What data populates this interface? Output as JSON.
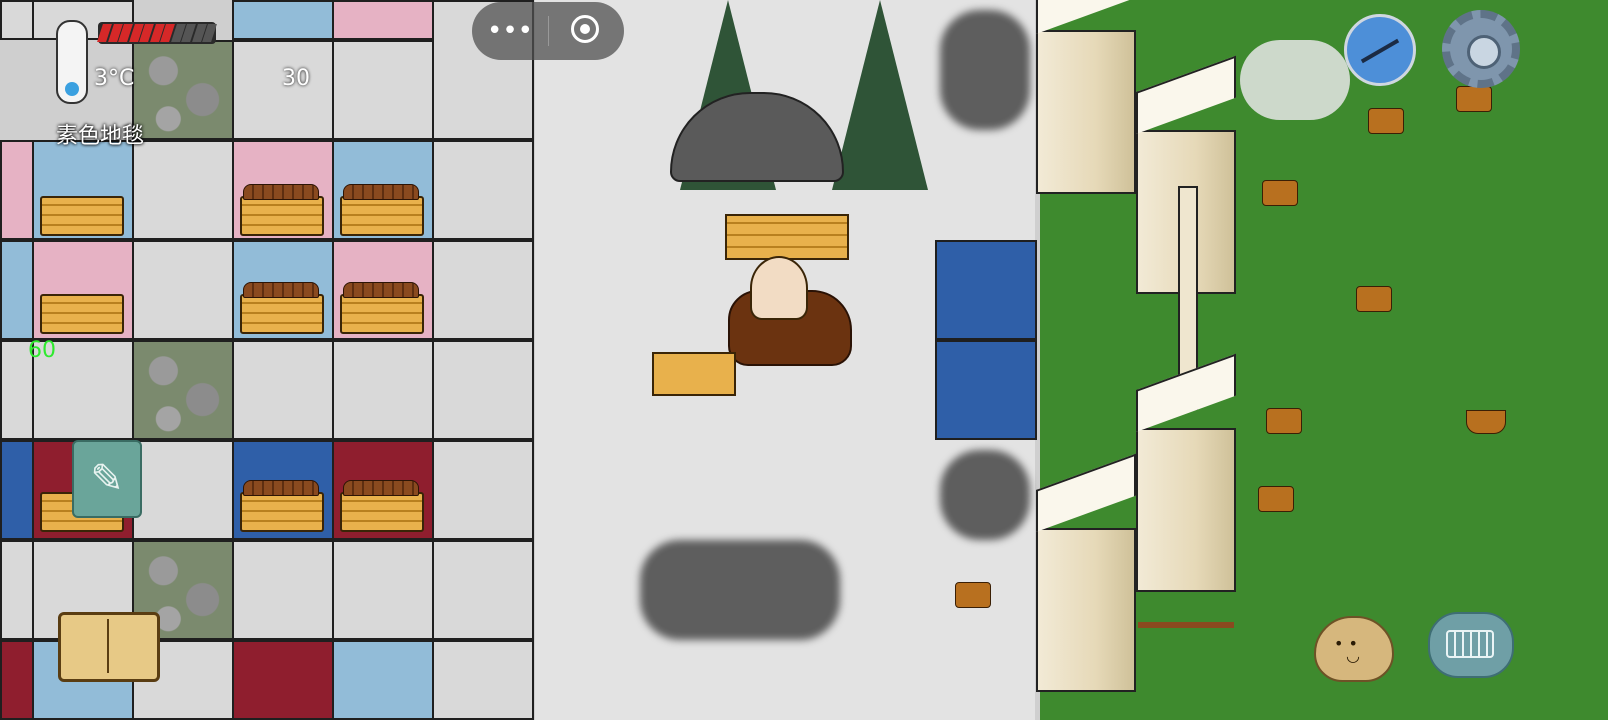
{
  "hud": {
    "temperature": "3°C",
    "food_pips_total": 11,
    "food_pips_filled": 7,
    "food_value": "30",
    "held_item": "素色地毯",
    "age": "60"
  },
  "mini_program_capsule": {
    "more_glyph": "•••",
    "close_label": ""
  },
  "buttons": {
    "note_glyph": "✎"
  },
  "colors": {
    "accent_green": "#2eea2e",
    "food_red": "#d62828",
    "grass": "#3e8a2e"
  },
  "icons": [
    "thermometer-icon",
    "food-bar-icon",
    "more-icon",
    "close-target-icon",
    "compass-icon",
    "settings-gear-icon",
    "pen-note-icon",
    "recipe-book-icon",
    "emote-face-icon",
    "keyboard-icon"
  ]
}
